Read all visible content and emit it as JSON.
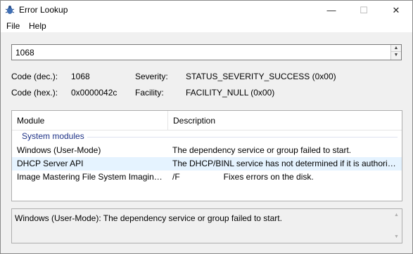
{
  "window": {
    "title": "Error Lookup",
    "icon": "bug-icon",
    "minimize_glyph": "—",
    "maximize_glyph": "☐",
    "close_glyph": "✕"
  },
  "menu": {
    "file": "File",
    "help": "Help"
  },
  "search": {
    "value": "1068",
    "spin_up": "▲",
    "spin_down": "▼"
  },
  "info": {
    "code_dec_label": "Code (dec.):",
    "code_dec_value": "1068",
    "code_hex_label": "Code (hex.):",
    "code_hex_value": "0x0000042c",
    "severity_label": "Severity:",
    "severity_value": "STATUS_SEVERITY_SUCCESS (0x00)",
    "facility_label": "Facility:",
    "facility_value": "FACILITY_NULL (0x00)"
  },
  "table": {
    "columns": {
      "module": "Module",
      "description": "Description"
    },
    "group": "System modules",
    "rows": [
      {
        "module": "Windows (User-Mode)",
        "description": "The dependency service or group failed to start."
      },
      {
        "module": "DHCP Server API",
        "description": "The DHCP/BINL service has not determined if it is authorized in current domain."
      },
      {
        "module": "Image Mastering File System Imaging API...",
        "description_a": "/F",
        "description_b": "Fixes errors on the disk."
      }
    ]
  },
  "detail": {
    "text": "Windows (User-Mode): The dependency service or group failed to start."
  },
  "colors": {
    "selected_row": "#e5f3ff",
    "group_label": "#1e3287"
  }
}
